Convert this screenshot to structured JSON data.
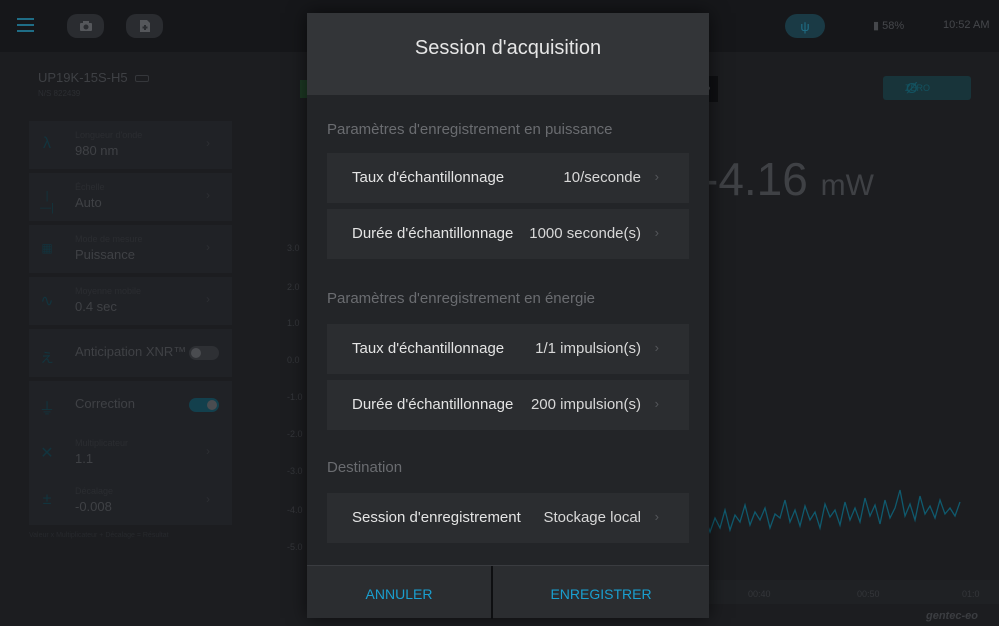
{
  "topbar": {
    "battery": "58%",
    "clock": "10:52 AM"
  },
  "device": {
    "name": "UP19K-15S-H5",
    "serial": "N/S 822439"
  },
  "sidebar": {
    "items": [
      {
        "label": "Longueur d'onde",
        "value": "980 nm",
        "icon": "lambda-icon"
      },
      {
        "label": "Échelle",
        "value": "Auto",
        "icon": "range-icon"
      },
      {
        "label": "Mode de mesure",
        "value": "Puissance",
        "icon": "grid-icon"
      },
      {
        "label": "Moyenne mobile",
        "value": "0.4 sec",
        "icon": "wave-icon"
      },
      {
        "label": "Anticipation XNR™",
        "toggle": "off",
        "icon": "runner-icon"
      },
      {
        "label": "Correction",
        "toggle": "on",
        "icon": "correction-icon"
      },
      {
        "label": "Multiplicateur",
        "value": "1.1",
        "icon": "multiply-icon"
      },
      {
        "label": "Décalage",
        "value": "-0.008",
        "icon": "offset-icon"
      }
    ],
    "footnote": "Valeur x Multiplicateur + Décalage = Résultat"
  },
  "measurement": {
    "value": "-4.16",
    "unit": "mW",
    "zero_label": "ZÉRO",
    "zero_symbol": "Ø"
  },
  "chart": {
    "y_ticks": [
      "3.0",
      "2.0",
      "1.0",
      "0.0",
      "-1.0",
      "-2.0",
      "-3.0",
      "-4.0",
      "-5.0"
    ],
    "time_labels": [
      "00:40",
      "00:50",
      "01:0"
    ]
  },
  "brand": "gentec-eo",
  "modal": {
    "title": "Session d'acquisition",
    "sections": [
      {
        "title": "Paramètres d'enregistrement en puissance",
        "rows": [
          {
            "label": "Taux d'échantillonnage",
            "value": "10/seconde"
          },
          {
            "label": "Durée d'échantillonnage",
            "value": "1000 seconde(s)"
          }
        ]
      },
      {
        "title": "Paramètres d'enregistrement en énergie",
        "rows": [
          {
            "label": "Taux d'échantillonnage",
            "value": "1/1 impulsion(s)"
          },
          {
            "label": "Durée d'échantillonnage",
            "value": "200 impulsion(s)"
          }
        ]
      },
      {
        "title": "Destination",
        "rows": [
          {
            "label": "Session d'enregistrement",
            "value": "Stockage local"
          }
        ]
      }
    ],
    "cancel_label": "ANNULER",
    "save_label": "ENREGISTRER"
  }
}
